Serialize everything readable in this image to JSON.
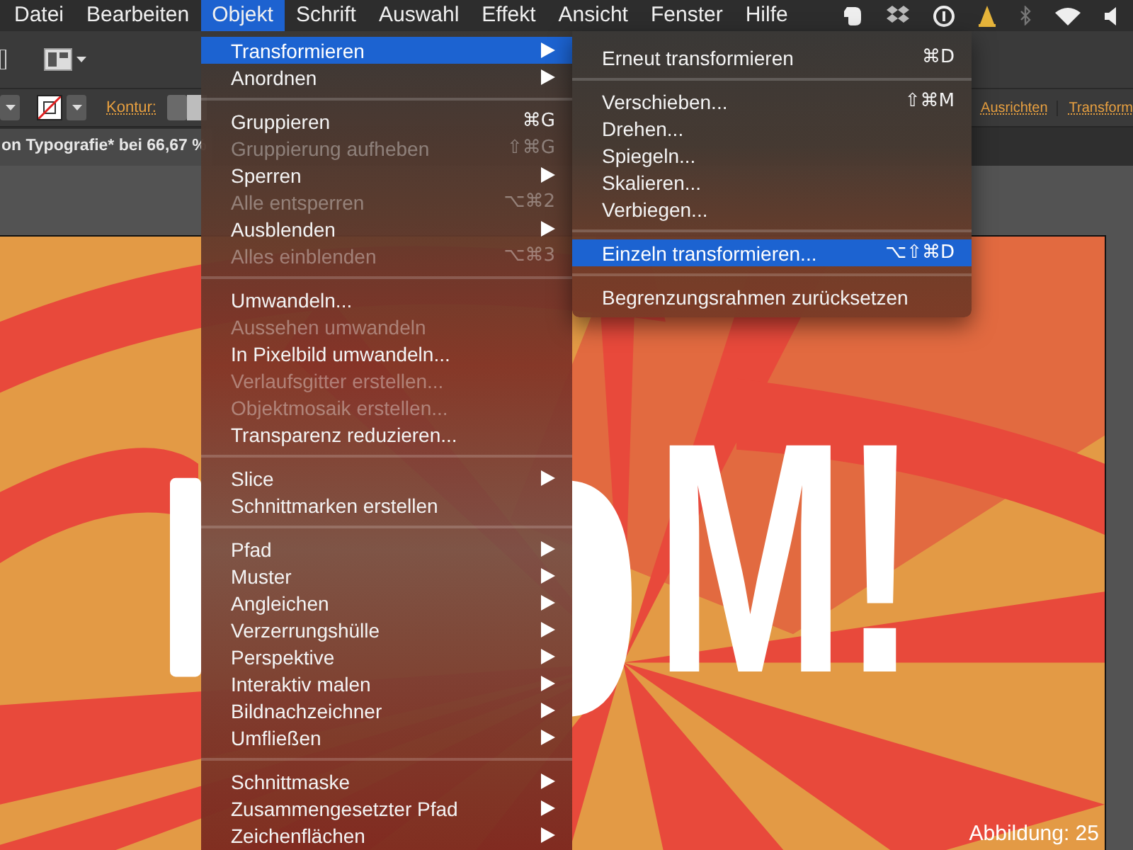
{
  "menu_bar": [
    {
      "label": "Datei",
      "selected": false
    },
    {
      "label": "Bearbeiten",
      "selected": false
    },
    {
      "label": "Objekt",
      "selected": true
    },
    {
      "label": "Schrift",
      "selected": false
    },
    {
      "label": "Auswahl",
      "selected": false
    },
    {
      "label": "Effekt",
      "selected": false
    },
    {
      "label": "Ansicht",
      "selected": false
    },
    {
      "label": "Fenster",
      "selected": false
    },
    {
      "label": "Hilfe",
      "selected": false
    }
  ],
  "control_bar": {
    "stroke_label": "Kontur:",
    "links": [
      "Ausrichten",
      "Transform"
    ]
  },
  "document_tab": "on Typografie* bei 66,67 %",
  "artwork": {
    "text": "M!"
  },
  "caption": "Abbildung: 25",
  "objekt_menu": [
    {
      "kind": "item",
      "label": "Transformieren",
      "submenu": true,
      "disabled": false,
      "selected": true
    },
    {
      "kind": "item",
      "label": "Anordnen",
      "submenu": true,
      "disabled": false,
      "selected": false
    },
    {
      "kind": "separator"
    },
    {
      "kind": "item",
      "label": "Gruppieren",
      "shortcut": "⌘G",
      "submenu": false,
      "disabled": false,
      "selected": false
    },
    {
      "kind": "item",
      "label": "Gruppierung aufheben",
      "shortcut": "⇧⌘G",
      "submenu": false,
      "disabled": true,
      "selected": false
    },
    {
      "kind": "item",
      "label": "Sperren",
      "submenu": true,
      "disabled": false,
      "selected": false
    },
    {
      "kind": "item",
      "label": "Alle entsperren",
      "shortcut": "⌥⌘2",
      "submenu": false,
      "disabled": true,
      "selected": false
    },
    {
      "kind": "item",
      "label": "Ausblenden",
      "submenu": true,
      "disabled": false,
      "selected": false
    },
    {
      "kind": "item",
      "label": "Alles einblenden",
      "shortcut": "⌥⌘3",
      "submenu": false,
      "disabled": true,
      "selected": false
    },
    {
      "kind": "separator"
    },
    {
      "kind": "item",
      "label": "Umwandeln...",
      "submenu": false,
      "disabled": false,
      "selected": false
    },
    {
      "kind": "item",
      "label": "Aussehen umwandeln",
      "submenu": false,
      "disabled": true,
      "selected": false
    },
    {
      "kind": "item",
      "label": "In Pixelbild umwandeln...",
      "submenu": false,
      "disabled": false,
      "selected": false
    },
    {
      "kind": "item",
      "label": "Verlaufsgitter erstellen...",
      "submenu": false,
      "disabled": true,
      "selected": false
    },
    {
      "kind": "item",
      "label": "Objektmosaik erstellen...",
      "submenu": false,
      "disabled": true,
      "selected": false
    },
    {
      "kind": "item",
      "label": "Transparenz reduzieren...",
      "submenu": false,
      "disabled": false,
      "selected": false
    },
    {
      "kind": "separator"
    },
    {
      "kind": "item",
      "label": "Slice",
      "submenu": true,
      "disabled": false,
      "selected": false
    },
    {
      "kind": "item",
      "label": "Schnittmarken erstellen",
      "submenu": false,
      "disabled": false,
      "selected": false
    },
    {
      "kind": "separator"
    },
    {
      "kind": "item",
      "label": "Pfad",
      "submenu": true,
      "disabled": false,
      "selected": false
    },
    {
      "kind": "item",
      "label": "Muster",
      "submenu": true,
      "disabled": false,
      "selected": false
    },
    {
      "kind": "item",
      "label": "Angleichen",
      "submenu": true,
      "disabled": false,
      "selected": false
    },
    {
      "kind": "item",
      "label": "Verzerrungshülle",
      "submenu": true,
      "disabled": false,
      "selected": false
    },
    {
      "kind": "item",
      "label": "Perspektive",
      "submenu": true,
      "disabled": false,
      "selected": false
    },
    {
      "kind": "item",
      "label": "Interaktiv malen",
      "submenu": true,
      "disabled": false,
      "selected": false
    },
    {
      "kind": "item",
      "label": "Bildnachzeichner",
      "submenu": true,
      "disabled": false,
      "selected": false
    },
    {
      "kind": "item",
      "label": "Umfließen",
      "submenu": true,
      "disabled": false,
      "selected": false
    },
    {
      "kind": "separator"
    },
    {
      "kind": "item",
      "label": "Schnittmaske",
      "submenu": true,
      "disabled": false,
      "selected": false
    },
    {
      "kind": "item",
      "label": "Zusammengesetzter Pfad",
      "submenu": true,
      "disabled": false,
      "selected": false
    },
    {
      "kind": "item",
      "label": "Zeichenflächen",
      "submenu": true,
      "disabled": false,
      "selected": false
    }
  ],
  "transform_submenu": [
    {
      "kind": "item",
      "label": "Erneut transformieren",
      "shortcut": "⌘D",
      "selected": false
    },
    {
      "kind": "separator"
    },
    {
      "kind": "item",
      "label": "Verschieben...",
      "shortcut": "⇧⌘M",
      "selected": false
    },
    {
      "kind": "item",
      "label": "Drehen...",
      "selected": false
    },
    {
      "kind": "item",
      "label": "Spiegeln...",
      "selected": false
    },
    {
      "kind": "item",
      "label": "Skalieren...",
      "selected": false
    },
    {
      "kind": "item",
      "label": "Verbiegen...",
      "selected": false
    },
    {
      "kind": "separator"
    },
    {
      "kind": "item",
      "label": "Einzeln transformieren...",
      "shortcut": "⌥⇧⌘D",
      "selected": true
    },
    {
      "kind": "separator"
    },
    {
      "kind": "item",
      "label": "Begrenzungsrahmen zurücksetzen",
      "selected": false
    }
  ]
}
